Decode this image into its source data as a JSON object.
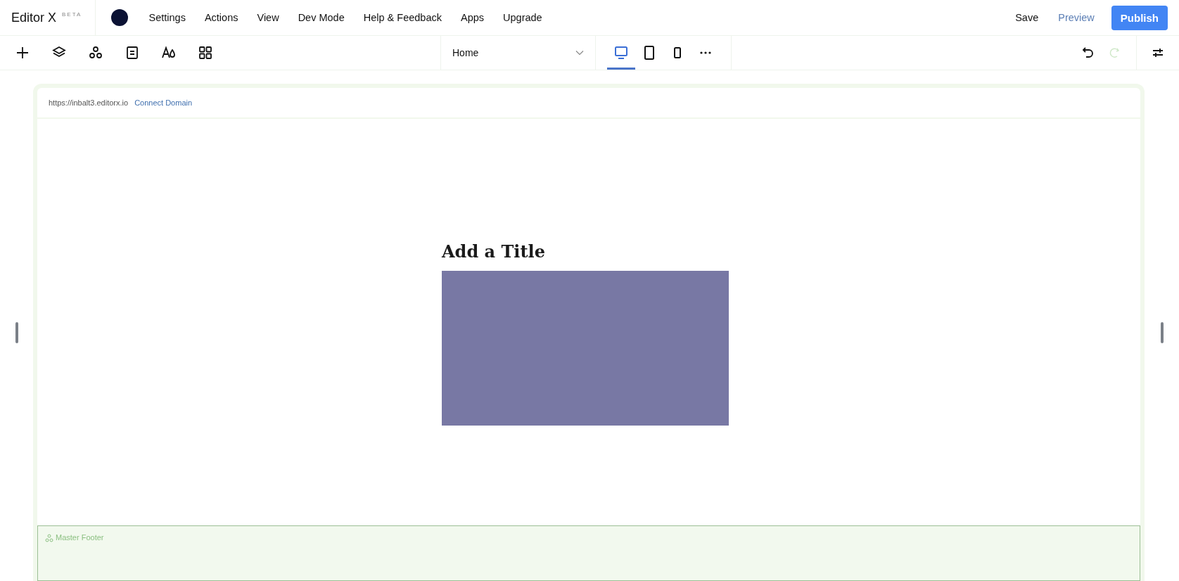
{
  "brand": {
    "name": "Editor X",
    "badge": "BETA"
  },
  "menu": [
    "Settings",
    "Actions",
    "View",
    "Dev Mode",
    "Help & Feedback",
    "Apps",
    "Upgrade"
  ],
  "actions": {
    "save": "Save",
    "preview": "Preview",
    "publish": "Publish"
  },
  "tools": [
    {
      "kind": "add"
    },
    {
      "kind": "layers"
    },
    {
      "kind": "components"
    },
    {
      "kind": "pages"
    },
    {
      "kind": "design"
    },
    {
      "kind": "apps"
    }
  ],
  "page_select": {
    "value": "Home"
  },
  "devices": [
    {
      "kind": "desktop",
      "selected": true
    },
    {
      "kind": "tablet",
      "selected": false
    },
    {
      "kind": "mobile",
      "selected": false
    }
  ],
  "undo": {
    "disabled": false
  },
  "redo": {
    "disabled": true
  },
  "site": {
    "url": "https://inbalt3.editorx.io",
    "link": "Connect Domain"
  },
  "content": {
    "title": "Add a Title"
  },
  "footer": {
    "label": "Master Footer"
  }
}
